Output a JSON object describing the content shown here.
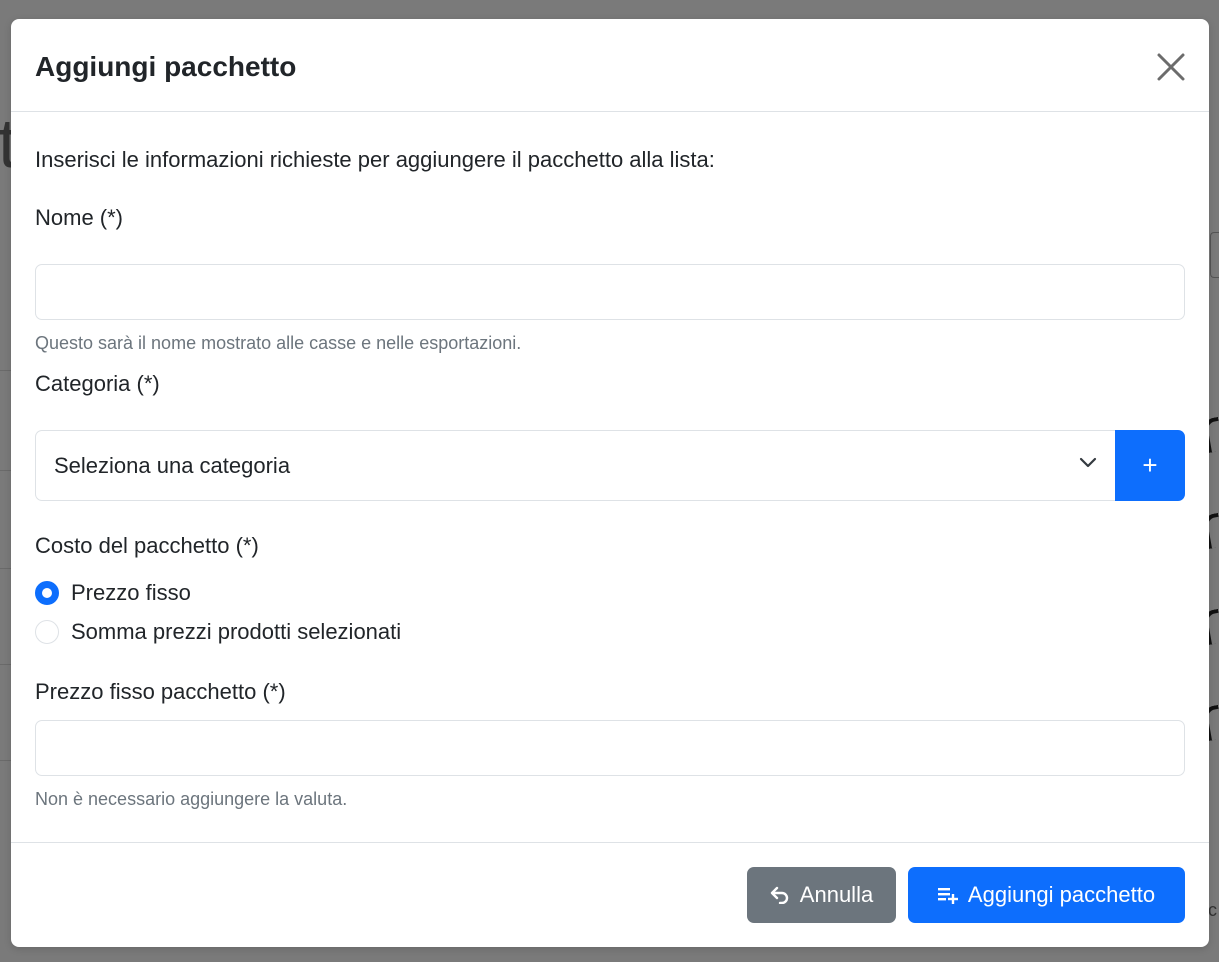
{
  "background": {
    "fragment_letter": "t",
    "fragment_right": "c"
  },
  "modal": {
    "title": "Aggiungi pacchetto",
    "close_icon": "close-icon",
    "intro": "Inserisci le informazioni richieste per aggiungere il pacchetto alla lista:",
    "fields": {
      "name": {
        "label": "Nome (*)",
        "value": "",
        "placeholder": "",
        "help": "Questo sarà il nome mostrato alle casse e nelle esportazioni."
      },
      "category": {
        "label": "Categoria (*)",
        "selected": "Seleziona una categoria",
        "add_label": "+"
      },
      "cost": {
        "label": "Costo del pacchetto (*)",
        "options": [
          {
            "label": "Prezzo fisso",
            "checked": true
          },
          {
            "label": "Somma prezzi prodotti selezionati",
            "checked": false
          }
        ]
      },
      "fixed_price": {
        "label": "Prezzo fisso pacchetto (*)",
        "value": "",
        "placeholder": "",
        "help": "Non è necessario aggiungere la valuta."
      }
    },
    "footer": {
      "cancel_label": "Annulla",
      "cancel_icon": "undo-icon",
      "submit_label": "Aggiungi pacchetto",
      "submit_icon": "playlist-add-icon"
    }
  },
  "colors": {
    "primary": "#0d6efd",
    "secondary": "#6c757d",
    "overlay": "#7a7a7a",
    "border": "#dee2e6",
    "muted_text": "#6c757d",
    "text": "#212529"
  }
}
